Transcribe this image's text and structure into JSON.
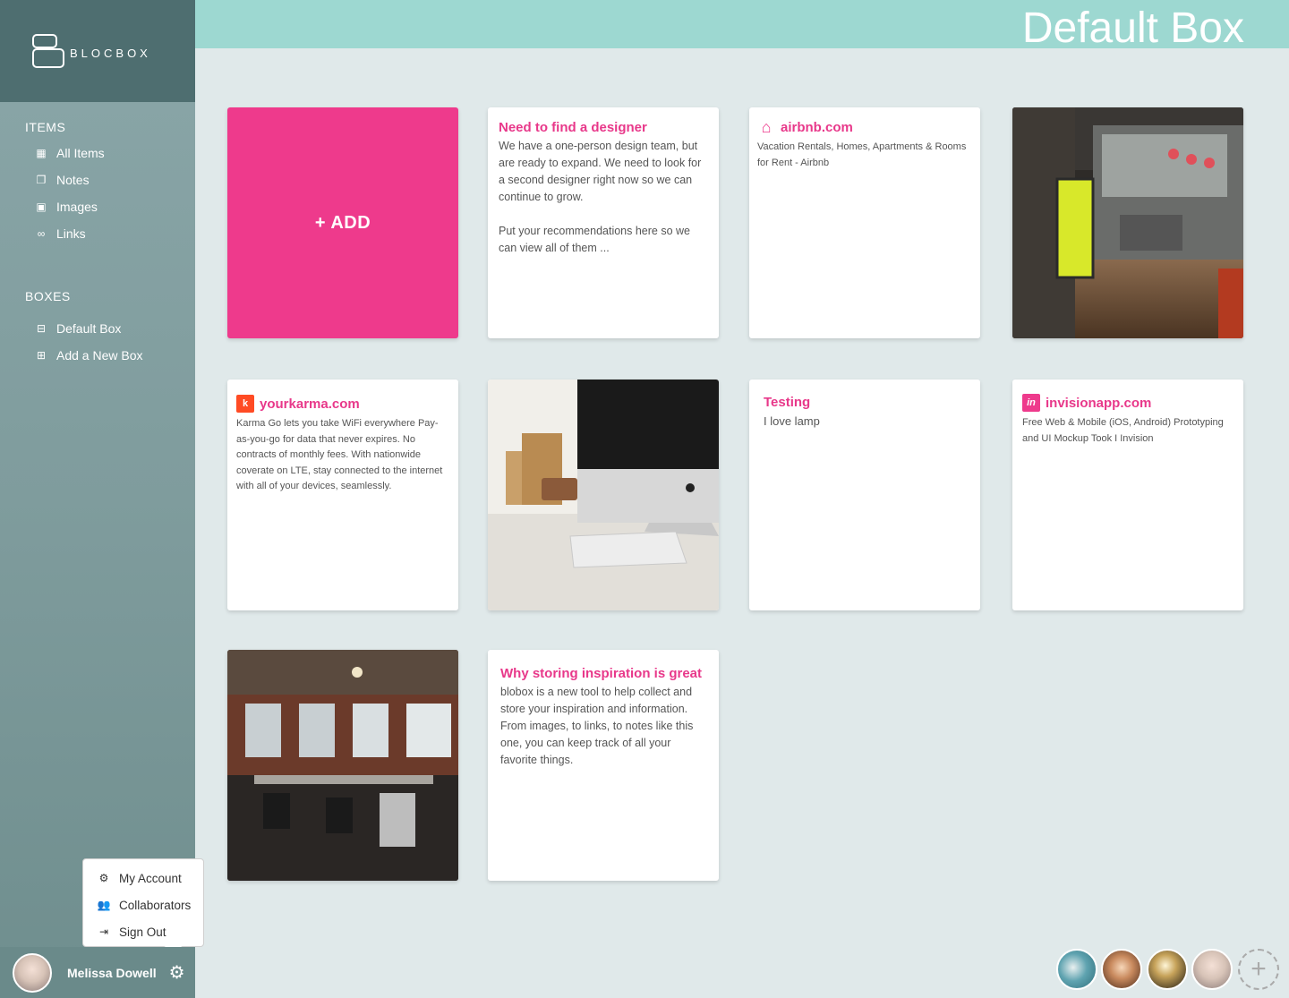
{
  "app": {
    "logo_text": "BLOCBOX"
  },
  "header": {
    "title": "Default Box"
  },
  "sidebar": {
    "items_title": "ITEMS",
    "items": [
      {
        "label": "All Items",
        "icon": "grid-icon"
      },
      {
        "label": "Notes",
        "icon": "notes-icon"
      },
      {
        "label": "Images",
        "icon": "image-icon"
      },
      {
        "label": "Links",
        "icon": "link-icon"
      }
    ],
    "boxes_title": "BOXES",
    "boxes": [
      {
        "label": "Default Box",
        "icon": "inbox-icon"
      },
      {
        "label": "Add a New Box",
        "icon": "plus-square-icon"
      }
    ]
  },
  "cards": {
    "add": {
      "label": "+ ADD"
    },
    "note1": {
      "title": "Need to find a designer",
      "body": "We have a one-person design team, but are ready to expand. We need to look for a second designer right now so we can continue to grow.\n\nPut your recommendations here so we can view all of them ..."
    },
    "link_airbnb": {
      "title": "airbnb.com",
      "desc": "Vacation Rentals, Homes, Apartments & Rooms for Rent - Airbnb",
      "icon": "airbnb-icon"
    },
    "link_karma": {
      "title": "yourkarma.com",
      "desc": "Karma Go lets you take WiFi everywhere Pay-as-you-go for data that never expires. No contracts of monthly fees. With nationwide coverate on LTE, stay connected to the internet with all of your devices, seamlessly.",
      "icon": "karma-icon",
      "icon_glyph": "k"
    },
    "note_testing": {
      "title": "Testing",
      "body": "I love lamp"
    },
    "link_invision": {
      "title": "invisionapp.com",
      "desc": "Free Web & Mobile (iOS, Android) Prototyping and UI Mockup Took I Invision",
      "icon": "invision-icon",
      "icon_glyph": "in"
    },
    "note_why": {
      "title": "Why storing inspiration is great",
      "body": "blobox is a new tool to help collect and store your inspiration and information. From images, to links, to notes like this one, you can keep track of all your favorite things."
    }
  },
  "user_menu": {
    "items": [
      {
        "label": "My Account",
        "icon": "gear-icon"
      },
      {
        "label": "Collaborators",
        "icon": "users-icon"
      },
      {
        "label": "Sign Out",
        "icon": "sign-out-icon"
      }
    ]
  },
  "user": {
    "name": "Melissa Dowell"
  },
  "colors": {
    "accent": "#ee3a8c",
    "topbar": "#9dd8d1",
    "sidebar": "#7f9c9d",
    "background": "#e0e9ea"
  }
}
